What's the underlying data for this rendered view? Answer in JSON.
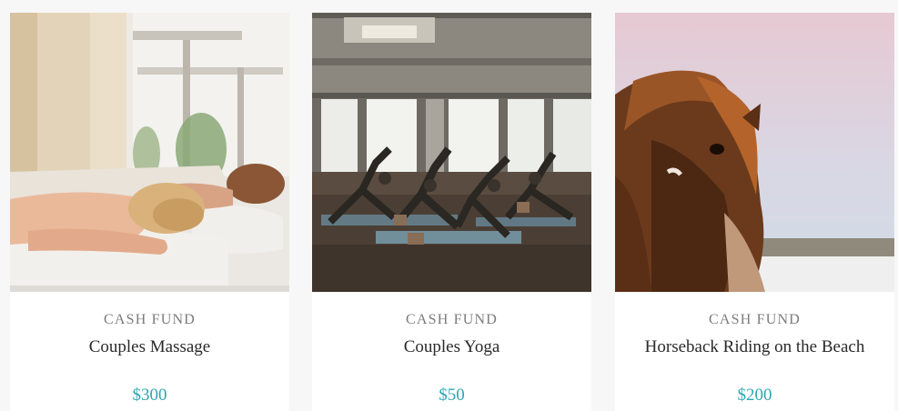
{
  "accent_color": "#2fa5b3",
  "funds": [
    {
      "label": "CASH FUND",
      "title": "Couples Massage",
      "price": "$300",
      "image_subject": "couples-massage-photo"
    },
    {
      "label": "CASH FUND",
      "title": "Couples Yoga",
      "price": "$50",
      "image_subject": "couples-yoga-photo"
    },
    {
      "label": "CASH FUND",
      "title": "Horseback Riding on the Beach",
      "price": "$200",
      "image_subject": "horseback-beach-photo"
    }
  ]
}
